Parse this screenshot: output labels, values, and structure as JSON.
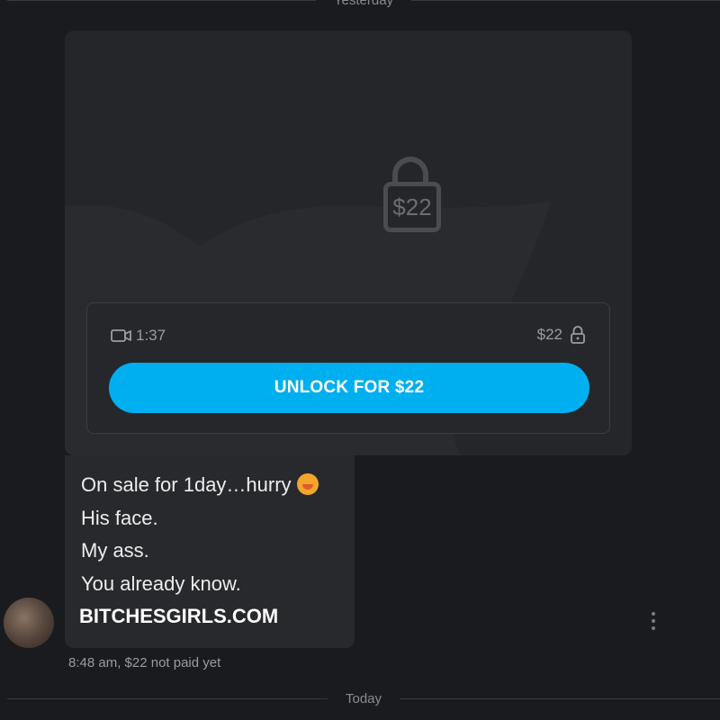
{
  "dividers": {
    "top_label": "Yesterday",
    "bottom_label": "Today"
  },
  "media_card": {
    "locked_price": "$22",
    "duration": "1:37",
    "price": "$22",
    "unlock_label": "UNLOCK FOR $22",
    "icons": [
      "lock-icon",
      "video-icon",
      "small-lock-icon"
    ],
    "accent_color": "#00aff0"
  },
  "message": {
    "lines": [
      "On sale for 1day…hurry",
      "His face.",
      "My ass.",
      "You already know."
    ],
    "watermark": "BITCHESGIRLS.COM"
  },
  "meta": {
    "text": "8:48 am,  $22 not paid yet"
  }
}
